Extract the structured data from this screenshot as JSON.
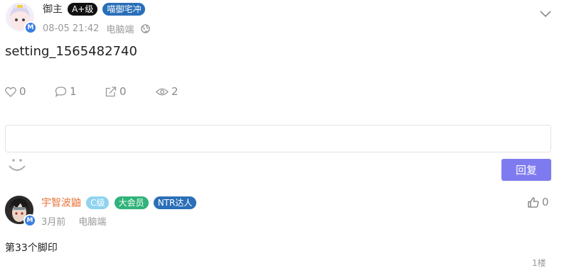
{
  "post": {
    "author": "御主",
    "badges": [
      "A+级",
      "喵御宅冲"
    ],
    "badge_colors": [
      "#111111",
      "#2a6fb8"
    ],
    "time": "08-05 21:42",
    "device": "电脑端",
    "avatar_badge": "M",
    "title": "setting_1565482740",
    "likes": "0",
    "comments": "1",
    "shares": "0",
    "views": "2"
  },
  "reply": {
    "button_label": "回复",
    "placeholder": ""
  },
  "comment": {
    "author": "宇智波鼬",
    "author_color": "#e8743b",
    "badges": [
      "C级",
      "大会员",
      "NTR达人"
    ],
    "badge_colors": [
      "#8fd3ef",
      "#2fb37a",
      "#2a6fb8"
    ],
    "time": "3月前",
    "device": "电脑端",
    "avatar_badge": "M",
    "likes": "0",
    "text": "第33个脚印",
    "floor": "1楼"
  },
  "icons": [
    "chevron-down-icon",
    "globe-icon",
    "heart-icon",
    "comment-icon",
    "share-icon",
    "eye-icon",
    "smiley-icon",
    "thumbs-up-icon"
  ]
}
